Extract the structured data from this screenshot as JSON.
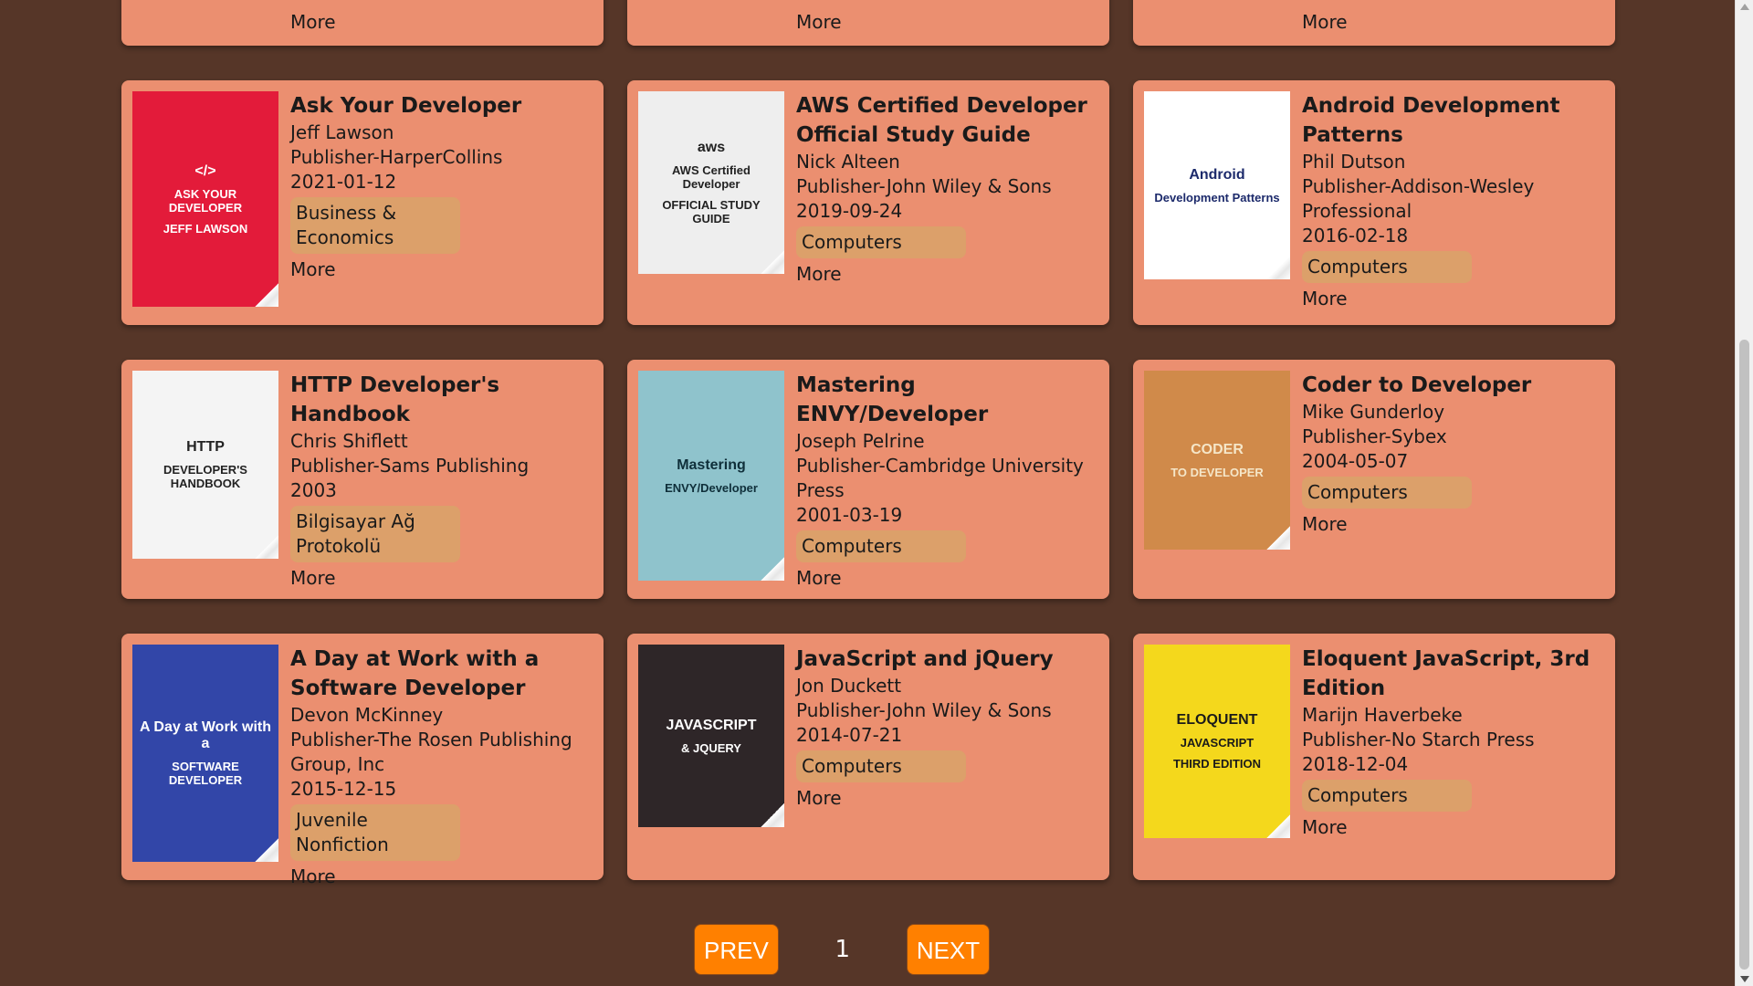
{
  "books": [
    {
      "title": "",
      "author": "",
      "publisher": "",
      "date": "",
      "category": "",
      "more": "More",
      "cover": {
        "bg": "#eb8f70",
        "lines": []
      }
    },
    {
      "title": "",
      "author": "",
      "publisher": "",
      "date": "",
      "category": "",
      "more": "More",
      "cover": {
        "bg": "#eb8f70",
        "lines": []
      }
    },
    {
      "title": "",
      "author": "",
      "publisher": "",
      "date": "",
      "category": "",
      "more": "More",
      "cover": {
        "bg": "#eb8f70",
        "lines": []
      }
    },
    {
      "title": "Ask Your Developer",
      "author": "Jeff Lawson",
      "publisher": "Publisher-HarperCollins",
      "date": "2021-01-12",
      "category": "Business & Economics",
      "more": "More",
      "cover": {
        "bg": "#e31b3a",
        "fg": "#ffffff",
        "lines": [
          "</>",
          "ASK YOUR DEVELOPER",
          "JEFF LAWSON"
        ]
      }
    },
    {
      "title": "AWS Certified Developer Official Study Guide",
      "author": "Nick Alteen",
      "publisher": "Publisher-John Wiley & Sons",
      "date": "2019-09-24",
      "category": "Computers",
      "more": "More",
      "cover": {
        "bg": "#eeeeee",
        "fg": "#222222",
        "lines": [
          "aws",
          "AWS Certified Developer",
          "OFFICIAL STUDY GUIDE"
        ]
      }
    },
    {
      "title": "Android Development Patterns",
      "author": "Phil Dutson",
      "publisher": "Publisher-Addison-Wesley Professional",
      "date": "2016-02-18",
      "category": "Computers",
      "more": "More",
      "cover": {
        "bg": "#ffffff",
        "fg": "#1c2a6b",
        "lines": [
          "Android",
          "Development Patterns"
        ]
      }
    },
    {
      "title": "HTTP Developer's Handbook",
      "author": "Chris Shiflett",
      "publisher": "Publisher-Sams Publishing",
      "date": "2003",
      "category": "Bilgisayar Ağ Protokolü",
      "more": "More",
      "cover": {
        "bg": "#f4f4f4",
        "fg": "#222222",
        "lines": [
          "HTTP",
          "DEVELOPER'S HANDBOOK"
        ]
      }
    },
    {
      "title": "Mastering ENVY/Developer",
      "author": "Joseph Pelrine",
      "publisher": "Publisher-Cambridge University Press",
      "date": "2001-03-19",
      "category": "Computers",
      "more": "More",
      "cover": {
        "bg": "#8fc3cc",
        "fg": "#0f2f3a",
        "lines": [
          "Mastering",
          "ENVY/Developer"
        ]
      }
    },
    {
      "title": "Coder to Developer",
      "author": "Mike Gunderloy",
      "publisher": "Publisher-Sybex",
      "date": "2004-05-07",
      "category": "Computers",
      "more": "More",
      "cover": {
        "bg": "#d08a4a",
        "fg": "#f5e6c8",
        "lines": [
          "CODER",
          "TO DEVELOPER"
        ]
      }
    },
    {
      "title": "A Day at Work with a Software Developer",
      "author": "Devon McKinney",
      "publisher": "Publisher-The Rosen Publishing Group, Inc",
      "date": "2015-12-15",
      "category": "Juvenile Nonfiction",
      "more": "More",
      "cover": {
        "bg": "#3246a8",
        "fg": "#ffffff",
        "lines": [
          "A Day at Work with a",
          "SOFTWARE DEVELOPER"
        ]
      }
    },
    {
      "title": "JavaScript and jQuery",
      "author": "Jon Duckett",
      "publisher": "Publisher-John Wiley & Sons",
      "date": "2014-07-21",
      "category": "Computers",
      "more": "More",
      "cover": {
        "bg": "#2e2628",
        "fg": "#ffffff",
        "lines": [
          "JAVASCRIPT",
          "& JQUERY"
        ]
      }
    },
    {
      "title": "Eloquent JavaScript, 3rd Edition",
      "author": "Marijn Haverbeke",
      "publisher": "Publisher-No Starch Press",
      "date": "2018-12-04",
      "category": "Computers",
      "more": "More",
      "cover": {
        "bg": "#f4d81c",
        "fg": "#1a1a1a",
        "lines": [
          "ELOQUENT",
          "JAVASCRIPT",
          "THIRD EDITION"
        ]
      }
    }
  ],
  "pagination": {
    "prev": "PREV",
    "page": "1",
    "next": "NEXT"
  },
  "colors": {
    "background": "#563628",
    "card": "#eb8f70",
    "tag": "#dca06a",
    "button": "#ff8000"
  }
}
